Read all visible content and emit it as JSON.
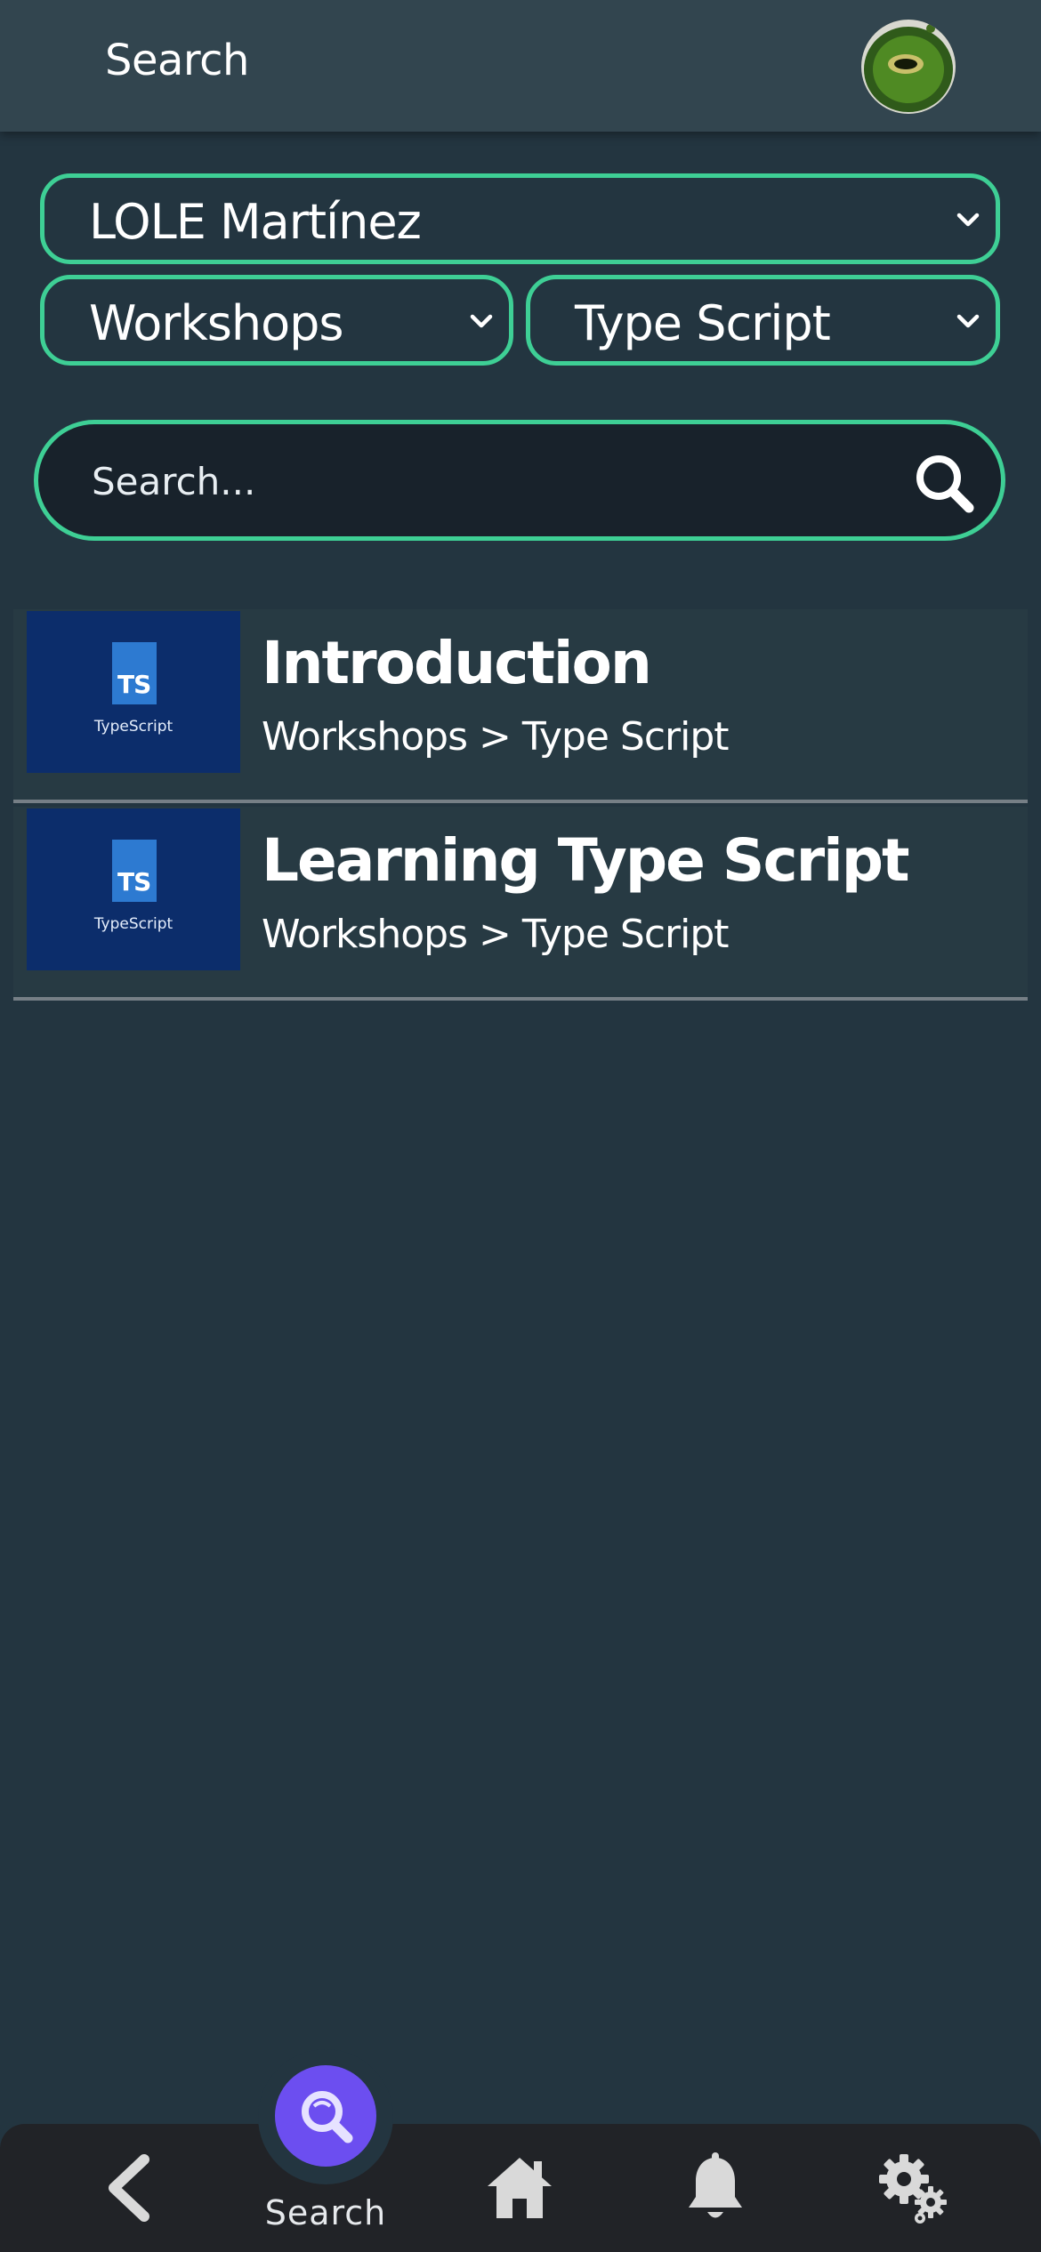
{
  "header": {
    "title": "Search",
    "avatar_icon": "kiwi-avatar-icon"
  },
  "filters": {
    "user": "LOLE Martínez",
    "category": "Workshops",
    "topic": "Type Script",
    "accent_color": "#3ecf95"
  },
  "search": {
    "placeholder": "Search...",
    "value": ""
  },
  "results": [
    {
      "title": "Introduction",
      "path": "Workshops > Type Script",
      "thumb_badge": "TS",
      "thumb_name": "TypeScript"
    },
    {
      "title": "Learning Type Script",
      "path": "Workshops > Type Script",
      "thumb_badge": "TS",
      "thumb_name": "TypeScript"
    }
  ],
  "nav": {
    "active_label": "Search",
    "active_color": "#6c4ef0",
    "items": [
      "back-icon",
      "search-icon",
      "home-icon",
      "bell-icon",
      "gear-icon"
    ]
  }
}
